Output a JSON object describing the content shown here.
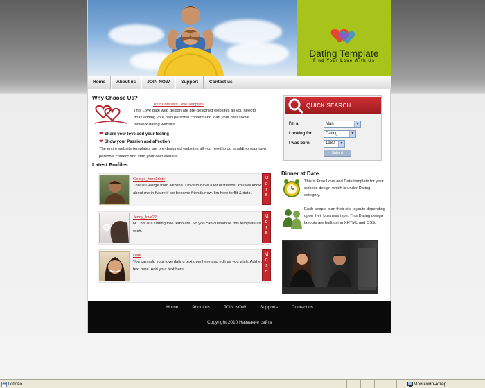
{
  "brand": {
    "title": "Dating Template",
    "tagline": "Find Your Love With Us",
    "accent_color": "#a8c41a"
  },
  "nav": {
    "items": [
      "Home",
      "About us",
      "JOIN NOW",
      "Support",
      "Contact us"
    ]
  },
  "why": {
    "title": "Why Choose Us?",
    "link": "Your Date with Love Template",
    "text": "This Love date web design are pre-designed websites all you needto do is adding your own personal content and start your own social network dating website.",
    "features": [
      "Share your love add your feeling",
      "Show your Passion and affection"
    ],
    "paragraph": "The entire website templates are pre-designed websites all you need to do is adding your own personal content and start your own website."
  },
  "profiles": {
    "title": "Latest Profiles",
    "more_label": "More",
    "items": [
      {
        "name": "George_hero2date",
        "desc": "This is George from Arizona. I love to have a lot of friends. You will know about me in future if we become friends now. I'm here to flit & date."
      },
      {
        "name": "Jenny_love22",
        "desc": "Hi This is a Dating free template, So you can customize this template as you wish."
      },
      {
        "name": "Date",
        "desc": "You can add your love dating text over here and edit as you wish. Add your text here. Add your text here"
      }
    ]
  },
  "quick_search": {
    "title": "QUICK SEARCH",
    "fields": [
      {
        "label": "I'm a",
        "value": "Man"
      },
      {
        "label": "Looking for",
        "value": "Dating"
      },
      {
        "label": "I was born",
        "value": "1980"
      }
    ],
    "submit_label": "Submit"
  },
  "dinner": {
    "title": "Dinner at Date",
    "items": [
      {
        "icon": "clock-icon",
        "text": "This is Free Love and Date template for your website design which is under Dating category."
      },
      {
        "icon": "people-icon",
        "text": "Each people plan their site layouts depending upon their business type. This Dating design layouts are built using XHTML and CSS."
      }
    ]
  },
  "footer": {
    "nav": [
      "Home",
      "About us",
      "JOIN NOW",
      "Supports",
      "Contact us"
    ],
    "copyright": "Copyright 2010 Название сайта"
  },
  "statusbar": {
    "left": "Готово",
    "right": "Мой компьютер"
  }
}
